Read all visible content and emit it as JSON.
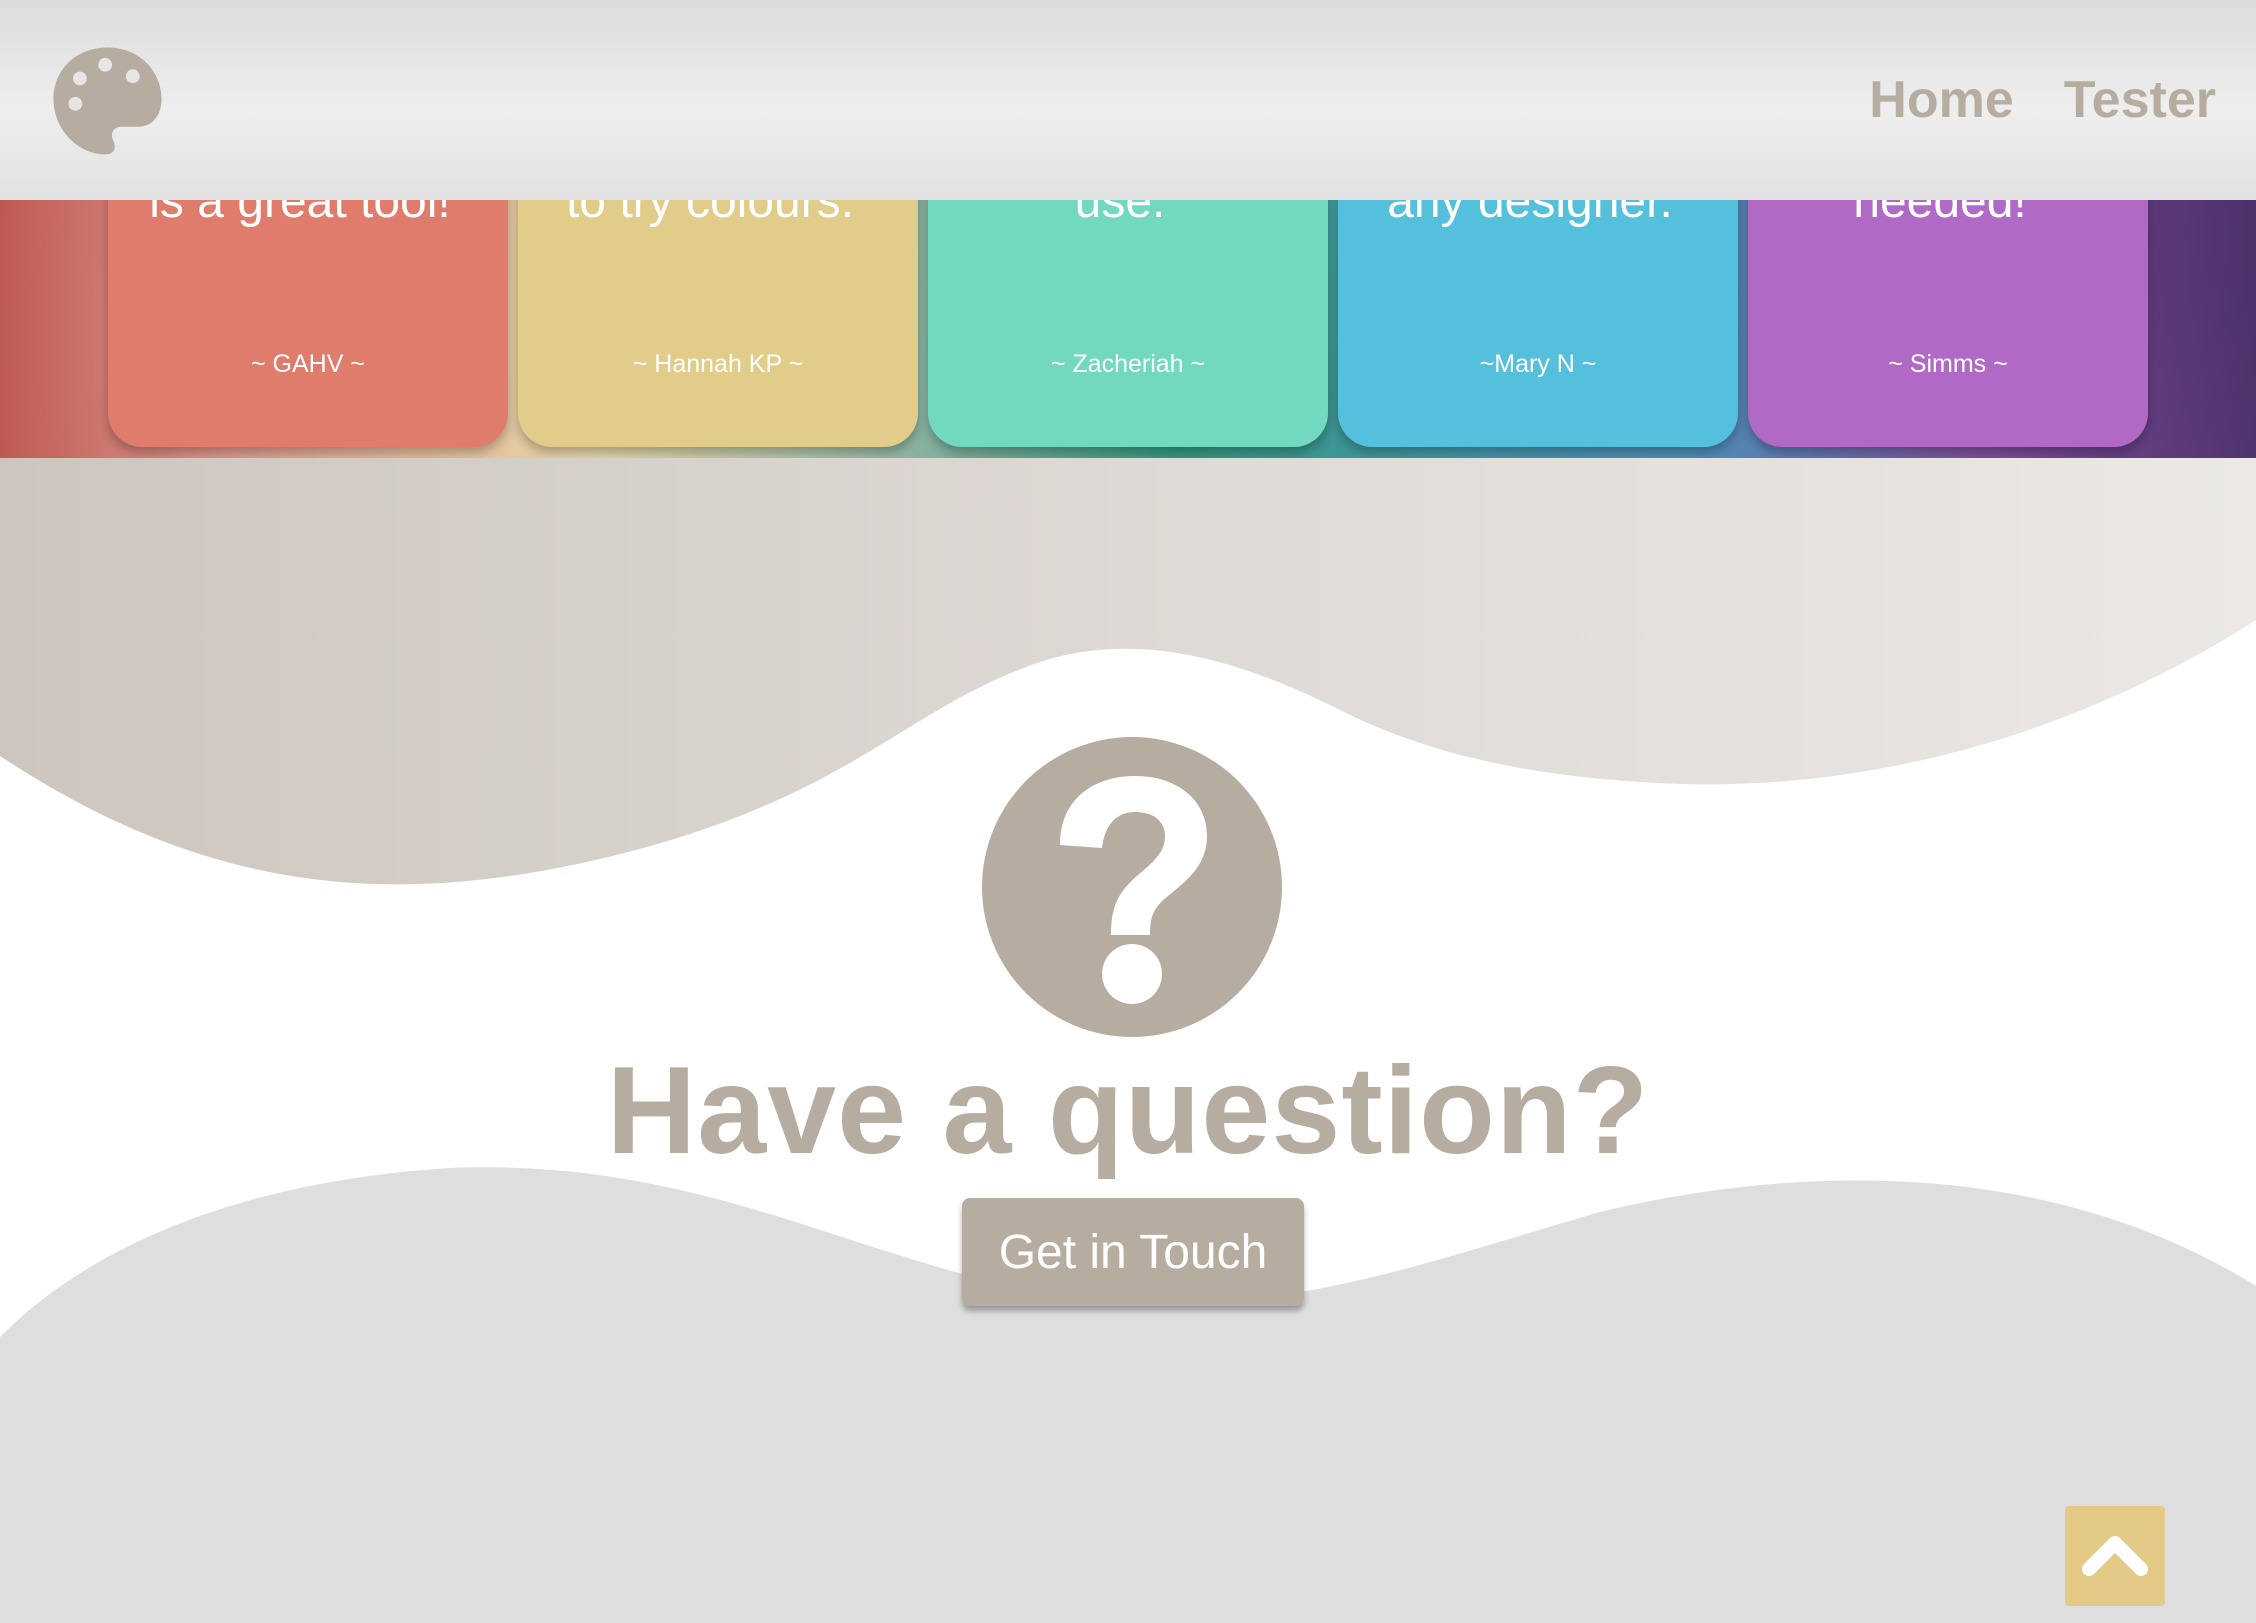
{
  "header": {
    "logo_icon": "palette-icon",
    "nav": [
      {
        "label": "Home"
      },
      {
        "label": "Tester"
      }
    ]
  },
  "testimonials": [
    {
      "quote": "“Colour Splash\nis a great tool!”",
      "author": "~ GAHV ~",
      "color": "#e07c6c"
    },
    {
      "quote": "“A simple way\nto try colours.”",
      "author": "~ Hannah KP ~",
      "color": "#e1cc8a"
    },
    {
      "quote": "“Very easy to\nuse.”",
      "author": "~ Zacheriah ~",
      "color": "#72d8c0"
    },
    {
      "quote": "“A great aid for\nany designer.”",
      "author": "~Mary N ~",
      "color": "#55c0dc"
    },
    {
      "quote": "“Just the tool I\nneeded!”",
      "author": "~ Simms ~",
      "color": "#b06ac6"
    }
  ],
  "question": {
    "icon": "question-circle-icon",
    "title": "Have a question?",
    "button_label": "Get in Touch"
  },
  "back_to_top": {
    "icon": "chevron-up-icon"
  },
  "colors": {
    "accent": "#b6ada0",
    "back_to_top": "#e3cb87",
    "footer": "#dedede"
  }
}
